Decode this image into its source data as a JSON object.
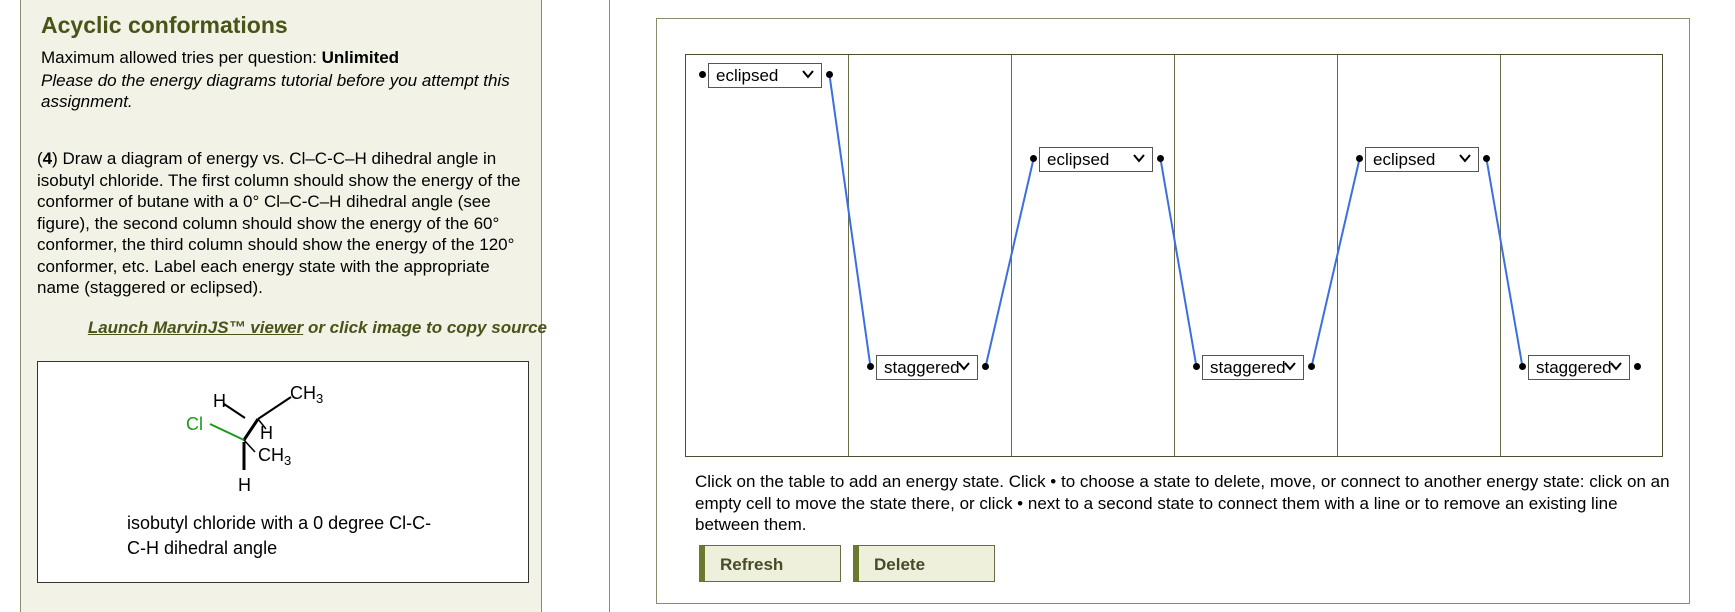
{
  "assignment": {
    "title": "Acyclic conformations",
    "tries_label": "Maximum allowed tries per question: ",
    "tries_value": "Unlimited",
    "tutorial_note": "Please do the energy diagrams tutorial before you attempt this assignment."
  },
  "question": {
    "number": "4",
    "text": "Draw a diagram of energy vs. Cl–C-C–H dihedral angle in isobutyl chloride. The first column should show the energy of the conformer of butane with a 0° Cl–C-C–H dihedral angle (see figure), the second column should show the energy of the 60° conformer, the third column should show the energy of the 120° conformer, etc. Label each energy state with the appropriate name (staggered or eclipsed)."
  },
  "viewer": {
    "launch_link": "Launch MarvinJS™ viewer",
    "launch_suffix": " or click image to copy source"
  },
  "molecule": {
    "atoms": {
      "H_top": "H",
      "CH3_top": "CH",
      "CH3_top_sub": "3",
      "Cl": "Cl",
      "H_mid": "H",
      "CH3_bot": "CH",
      "CH3_bot_sub": "3",
      "H_bot": "H"
    },
    "caption": "isobutyl chloride with a 0 degree Cl-C-C-H dihedral angle",
    "colors": {
      "chlorine": "#1a9a1a",
      "bond": "#000000"
    }
  },
  "diagram": {
    "columns": 6,
    "states": [
      {
        "column": 1,
        "label": "eclipsed",
        "level": "high"
      },
      {
        "column": 2,
        "label": "staggered",
        "level": "low"
      },
      {
        "column": 3,
        "label": "eclipsed",
        "level": "mid"
      },
      {
        "column": 4,
        "label": "staggered",
        "level": "low"
      },
      {
        "column": 5,
        "label": "eclipsed",
        "level": "mid"
      },
      {
        "column": 6,
        "label": "staggered",
        "level": "low"
      }
    ],
    "line_color": "#3b6fe0",
    "instructions": "Click on the table to add an energy state. Click • to choose a state to delete, move, or connect to another energy state: click on an empty cell to move the state there, or click • next to a second state to connect them with a line or to remove an existing line between them.",
    "buttons": {
      "refresh": "Refresh",
      "delete": "Delete"
    }
  }
}
